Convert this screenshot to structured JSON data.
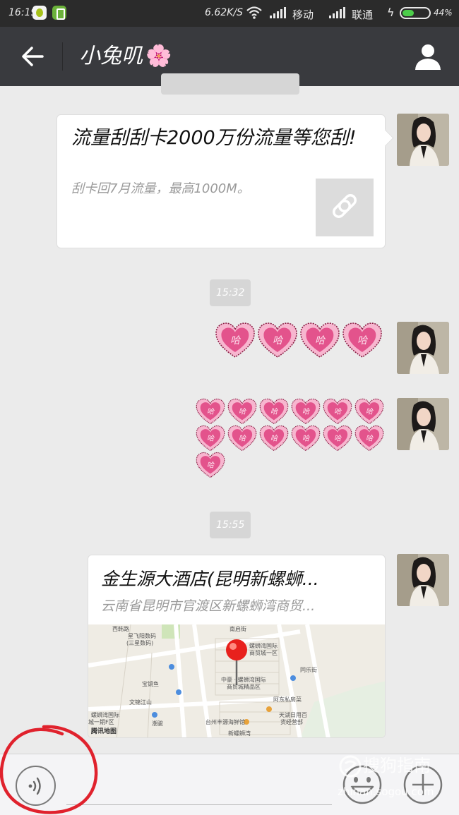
{
  "status_bar": {
    "time": "16:19",
    "network_speed": "6.62K/S",
    "carrier_1": "移动",
    "carrier_2": "联通",
    "battery": "44%"
  },
  "header": {
    "contact_name": "小兔叽",
    "name_emoji": "🌸"
  },
  "messages": {
    "link_card": {
      "title": "流量刮刮卡2000万份流量等您刮!",
      "description": "刮卡回7月流量，最高1000M。"
    },
    "time_1": "15:32",
    "stickers_row1": {
      "sticker": "哈",
      "count": 4
    },
    "stickers_row2": {
      "sticker": "哈",
      "count": 13
    },
    "time_2": "15:55",
    "location": {
      "name": "金生源大酒店(昆明新螺蛳...",
      "address": "云南省昆明市官渡区新螺蛳湾商贸...",
      "map_labels": [
        "南启街",
        "西韩路",
        "星飞阳数码",
        "(三星数码)",
        "螺蛳湾国际",
        "商贸城一区",
        "宝镜鱼",
        "中豪 · 螺蛳湾国际",
        "商贸城精品区",
        "同乐街",
        "文锦江山",
        "阿东私房菜",
        "螺蛳湾国际",
        "城一期F区",
        "潮骏",
        "台州丰源海鲜馆",
        "天湖日用百",
        "货经营部",
        "新螺蛳湾",
        "腾讯地图"
      ]
    }
  },
  "colors": {
    "titlebar": "#393a3e",
    "statusbar": "#2b2b2b",
    "chat_background": "#ebebeb",
    "annotation_circle": "#e0222d",
    "heart_pink": "#e3538c"
  },
  "watermark": {
    "brand": "搜狗指南",
    "url": "zhinan.sogou.com"
  }
}
